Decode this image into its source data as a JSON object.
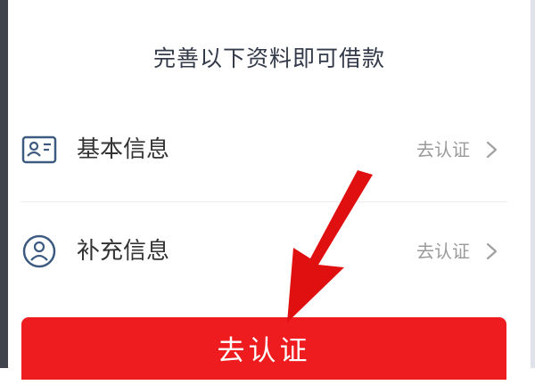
{
  "page": {
    "title": "完善以下资料即可借款"
  },
  "items": [
    {
      "label": "基本信息",
      "action": "去认证",
      "icon": "id-card-icon"
    },
    {
      "label": "补充信息",
      "action": "去认证",
      "icon": "user-circle-icon"
    }
  ],
  "cta": {
    "label": "去认证"
  },
  "colors": {
    "accent": "#ee1c1f",
    "title": "#333a4a",
    "icon_stroke": "#3d5a80",
    "muted": "#9a9a9a"
  }
}
